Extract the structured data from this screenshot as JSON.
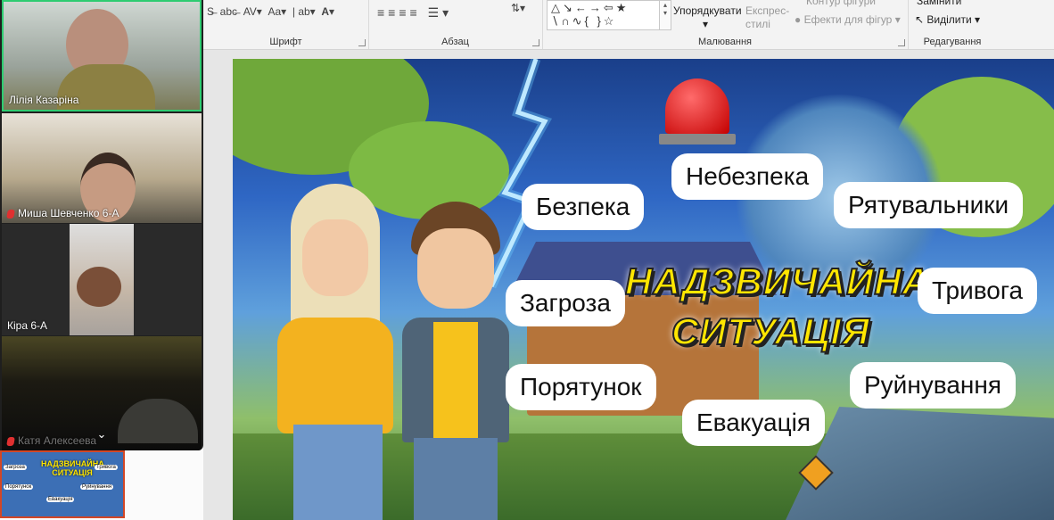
{
  "ribbon": {
    "groups": {
      "font": "Шрифт",
      "paragraph": "Абзац",
      "drawing": "Малювання",
      "editing": "Редагування"
    },
    "arrange": "Упорядкувати",
    "quick_styles": "Експрес-стилі",
    "shape_outline": "Контур фігури",
    "shape_effects": "Ефекти для фігур",
    "replace": "Замінити",
    "select": "Виділити"
  },
  "participants": [
    {
      "name": "Лілія Казаріна",
      "muted": false
    },
    {
      "name": "Миша Шевченко 6-А",
      "muted": true
    },
    {
      "name": "Кіра 6-А",
      "muted": false
    },
    {
      "name": "Катя Алексеева",
      "muted": true
    }
  ],
  "thumbnail": {
    "title": "НАДЗВИЧАЙНА СИТУАЦІЯ",
    "words": [
      "Загроза",
      "Тривога",
      "Порятунок",
      "Руйнування",
      "Евакуація"
    ]
  },
  "slide": {
    "title_line1": "НАДЗВИЧАЙНА",
    "title_line2": "СИТУАЦІЯ",
    "words": {
      "danger": "Небезпека",
      "safety": "Безпека",
      "rescuers": "Рятувальники",
      "threat": "Загроза",
      "alarm": "Тривога",
      "rescue": "Порятунок",
      "destruction": "Руйнування",
      "evacuation": "Евакуація"
    }
  },
  "colors": {
    "accent_active": "#2ecc71",
    "title_yellow": "#ffe600",
    "thumb_border": "#d24726"
  }
}
